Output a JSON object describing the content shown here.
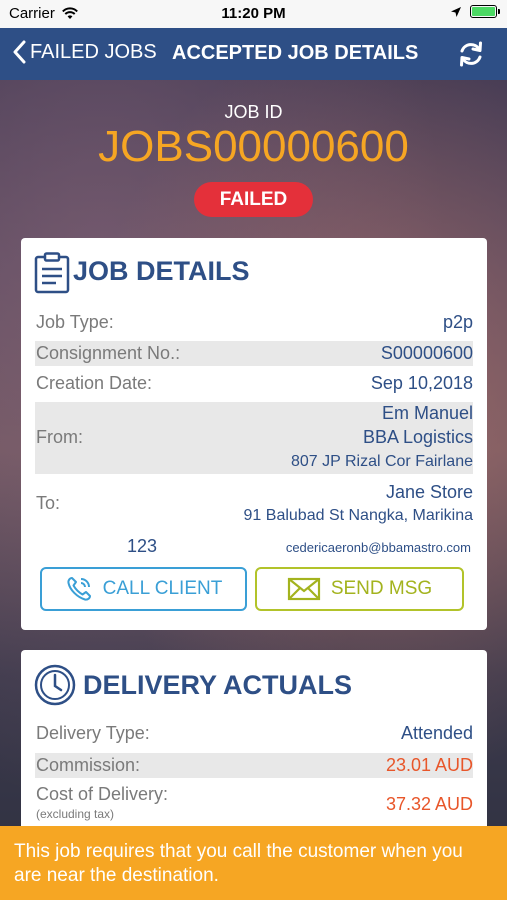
{
  "status_bar": {
    "carrier": "Carrier",
    "time": "11:20 PM",
    "battery_level": 1.0
  },
  "nav": {
    "back_label": "FAILED JOBS",
    "title": "ACCEPTED JOB DETAILS",
    "back_icon": "chevron-left-icon",
    "refresh_icon": "refresh-icon",
    "color": "#2e4f86"
  },
  "header": {
    "job_id_label": "JOB ID",
    "job_id": "JOBS00000600",
    "status": "FAILED",
    "job_id_color": "#f6a623",
    "status_color": "#e4303a"
  },
  "job_details": {
    "title": "JOB DETAILS",
    "icon": "clipboard-icon",
    "job_type_label": "Job Type:",
    "job_type": "p2p",
    "consignment_label": "Consignment No.:",
    "consignment": "S00000600",
    "creation_label": "Creation Date:",
    "creation_date": "Sep 10,2018",
    "from_label": "From:",
    "from_name": "Em Manuel",
    "from_company": "BBA Logistics",
    "from_address": "807 JP Rizal Cor Fairlane",
    "to_label": "To:",
    "to_name": "Jane Store",
    "to_address": "91 Balubad St Nangka, Marikina",
    "phone": "123",
    "email": "cedericaeronb@bbamastro.com",
    "call_button": "CALL CLIENT",
    "msg_button": "SEND MSG",
    "call_icon": "phone-icon",
    "msg_icon": "envelope-icon"
  },
  "delivery_actuals": {
    "title": "DELIVERY ACTUALS",
    "icon": "clock-icon",
    "type_label": "Delivery Type:",
    "type": "Attended",
    "commission_label": "Commission:",
    "commission": "23.01 AUD",
    "cost_label": "Cost of Delivery:",
    "cost_note": "(excluding tax)",
    "cost": "37.32 AUD"
  },
  "toast": {
    "message": "This job requires that you call the customer when you are near the destination.",
    "color": "#f6a623"
  }
}
